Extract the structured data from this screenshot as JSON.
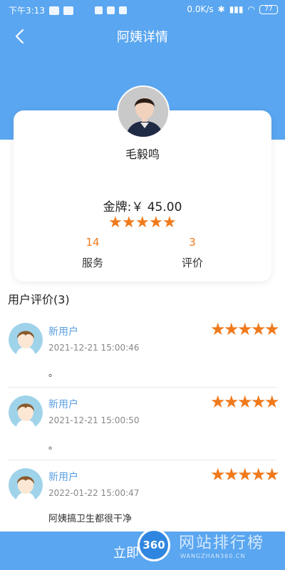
{
  "status_bar": {
    "time": "下午3:13",
    "network_speed": "0.0K/s",
    "battery": "77"
  },
  "header": {
    "title": "阿姨详情",
    "back_icon": "chevron-left-icon"
  },
  "profile": {
    "name": "毛毅鸣",
    "price": "金牌:￥ 45.00",
    "rating_stars": 5,
    "services_count": "14",
    "services_label": "服务",
    "reviews_count": "3",
    "reviews_label": "评价"
  },
  "reviews_section": {
    "title": "用户评价(3)",
    "items": [
      {
        "user": "新用户",
        "date": "2021-12-21 15:00:46",
        "comment": "。",
        "stars": 5
      },
      {
        "user": "新用户",
        "date": "2021-12-21 15:00:50",
        "comment": "。",
        "stars": 5
      },
      {
        "user": "新用户",
        "date": "2022-01-22 15:00:47",
        "comment": "阿姨搞卫生都很干净",
        "stars": 5
      }
    ]
  },
  "bottom": {
    "button_label": "立即"
  },
  "watermark": {
    "logo": "360",
    "text": "网站排行榜",
    "sub": "WANGZHAN360.CN"
  },
  "colors": {
    "primary": "#5aa6f0",
    "star": "#f07a1c",
    "username": "#5a9ee0"
  }
}
